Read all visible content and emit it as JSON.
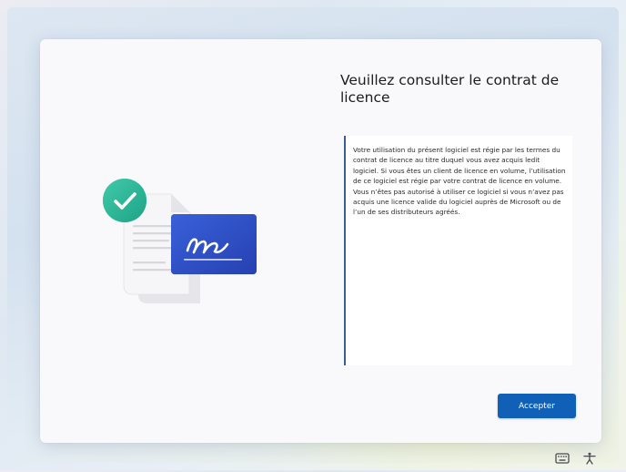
{
  "page": {
    "title": "Veuillez consulter le contrat de licence",
    "license_text": "Votre utilisation du présent logiciel est régie par les termes du contrat de licence au titre duquel vous avez acquis ledit logiciel. Si vous êtes un client de licence en volume, l’utilisation de ce logiciel est régie par votre contrat de licence en volume. Vous n’êtes pas autorisé à utiliser ce logiciel si vous n’avez pas acquis une licence valide du logiciel auprès de Microsoft ou de l’un de ses distributeurs agréés.",
    "accept_label": "Accepter"
  },
  "illustration": {
    "check_icon": "checkmark-icon",
    "signature_icon": "signature-icon",
    "document_icon": "document-icon",
    "colors": {
      "check": "#2db99a",
      "card": "#2f50c9",
      "document": "#f3f3f5"
    }
  },
  "taskbar": {
    "icons": [
      "keyboard-icon",
      "accessibility-icon"
    ]
  },
  "colors": {
    "accent": "#1060b8",
    "license_border": "#3a5f94"
  }
}
